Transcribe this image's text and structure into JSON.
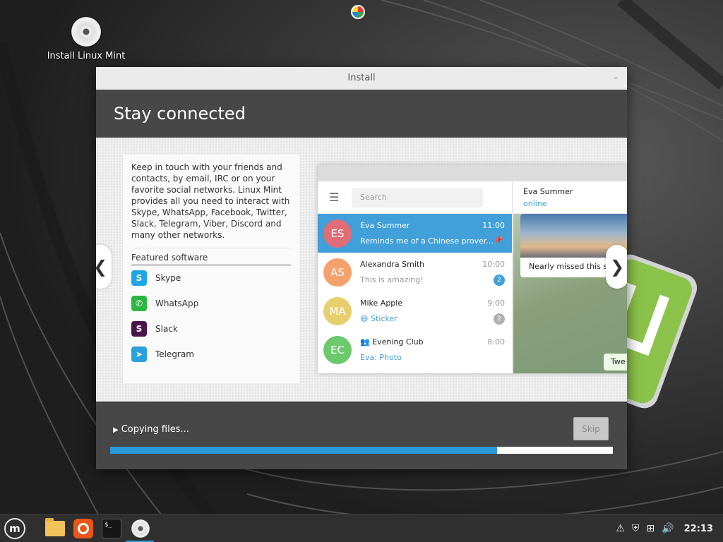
{
  "desktop": {
    "icon_label": "Install Linux Mint"
  },
  "window": {
    "title": "Install",
    "minimize_label": "–",
    "banner_title": "Stay connected"
  },
  "slide": {
    "description": "Keep in touch with your friends and contacts, by email, IRC or on your favorite social networks. Linux Mint provides all you need to interact with Skype, WhatsApp, Facebook, Twitter, Slack, Telegram, Viber, Discord and many other networks.",
    "featured_title": "Featured software",
    "apps": [
      {
        "name": "Skype",
        "icon": "skype-icon",
        "color": "#1ea6e4",
        "glyph": "S"
      },
      {
        "name": "WhatsApp",
        "icon": "whatsapp-icon",
        "color": "#2bb741",
        "glyph": "✆"
      },
      {
        "name": "Slack",
        "icon": "slack-icon",
        "color": "#4a154b",
        "glyph": "S"
      },
      {
        "name": "Telegram",
        "icon": "telegram-icon",
        "color": "#2aa1da",
        "glyph": "➤"
      }
    ],
    "prev_arrow": "❮",
    "next_arrow": "❯"
  },
  "mock_chat": {
    "search_placeholder": "Search",
    "chats": [
      {
        "initials": "ES",
        "name": "Eva Summer",
        "message": "Reminds me of a Chinese prover...",
        "time": "11:00",
        "badge": "",
        "pinned": true,
        "avatar_color": "#e06c75"
      },
      {
        "initials": "AS",
        "name": "Alexandra Smith",
        "message": "This is amazing!",
        "time": "10:00",
        "badge": "2",
        "badge_color": "#419fd9",
        "avatar_color": "#f5a16e"
      },
      {
        "initials": "MA",
        "name": "Mike Apple",
        "message": "😄 Sticker",
        "time": "9:00",
        "badge": "2",
        "badge_color": "#b0b0b0",
        "avatar_color": "#e8cf6e"
      },
      {
        "initials": "EC",
        "name": "👥 Evening Club",
        "message": "Eva: Photo",
        "time": "8:00",
        "badge": "",
        "avatar_color": "#6cc96c"
      }
    ],
    "contact_name": "Eva Summer",
    "contact_status": "online",
    "photo_caption": "Nearly missed this s",
    "reply_text": "Twe"
  },
  "progress": {
    "label": "Copying files...",
    "skip_label": "Skip",
    "fraction": 0.77,
    "accent": "#2a9ad8"
  },
  "taskbar": {
    "menu_glyph": "m",
    "terminal_text": "$_",
    "tray": [
      {
        "icon": "update-manager-icon",
        "glyph": "⚠"
      },
      {
        "icon": "shield-icon",
        "glyph": "⛨"
      },
      {
        "icon": "network-icon",
        "glyph": "⊞"
      },
      {
        "icon": "volume-icon",
        "glyph": "🔊"
      }
    ],
    "clock": "22:13"
  }
}
